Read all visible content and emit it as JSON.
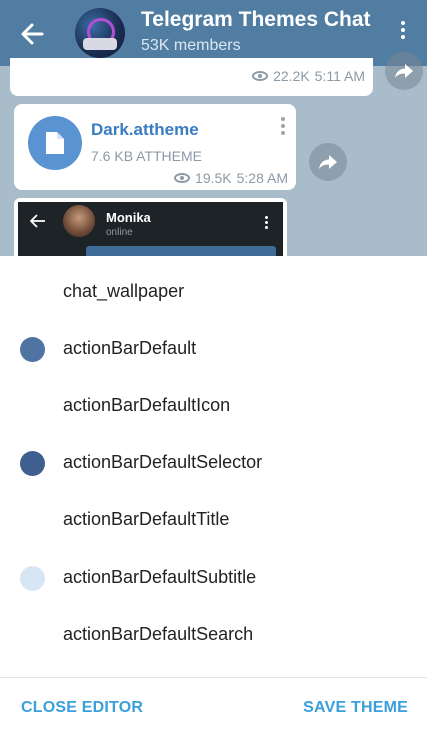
{
  "header": {
    "title": "Telegram Themes Chat",
    "members": "53K members",
    "color": "#517da2"
  },
  "chat": {
    "prev_message": {
      "views": "22.2K",
      "time": "5:11 AM"
    },
    "file": {
      "name": "Dark.attheme",
      "size": "7.6 KB ATTHEME",
      "views": "19.5K",
      "time": "5:28 AM"
    },
    "preview": {
      "name": "Monika",
      "status": "online"
    }
  },
  "editor": {
    "items": [
      {
        "label": "chat_wallpaper",
        "color": ""
      },
      {
        "label": "actionBarDefault",
        "color": "#4f74a3"
      },
      {
        "label": "actionBarDefaultIcon",
        "color": ""
      },
      {
        "label": "actionBarDefaultSelector",
        "color": "#3f5f8f"
      },
      {
        "label": "actionBarDefaultTitle",
        "color": ""
      },
      {
        "label": "actionBarDefaultSubtitle",
        "color": "#d6e6f5"
      },
      {
        "label": "actionBarDefaultSearch",
        "color": ""
      }
    ],
    "close_label": "CLOSE EDITOR",
    "save_label": "SAVE THEME"
  }
}
